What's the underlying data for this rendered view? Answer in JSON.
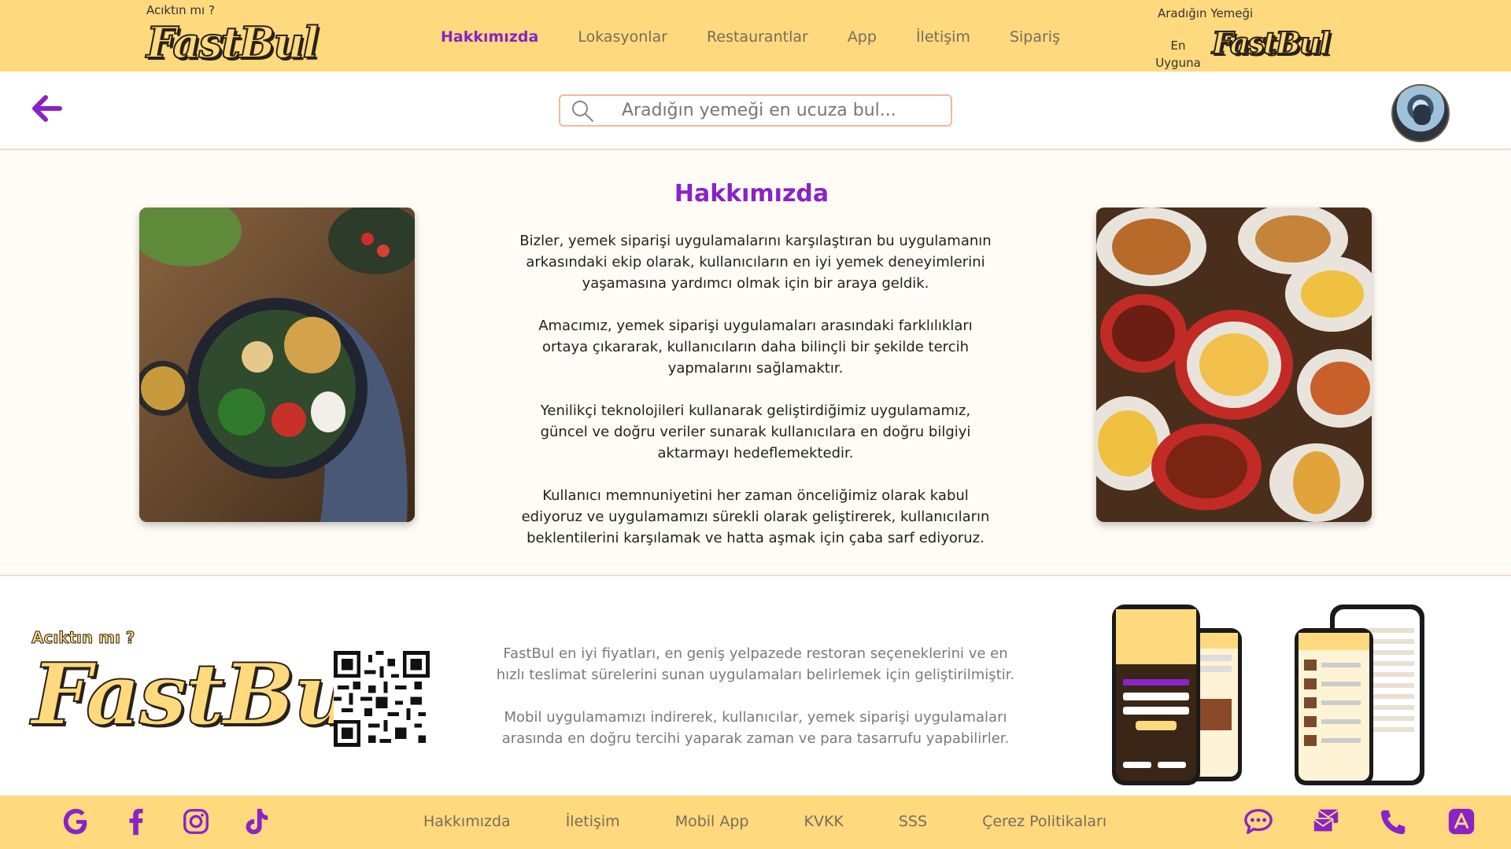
{
  "header": {
    "tagline": "Acıktın mı ?",
    "logo_text": "FastBul",
    "nav": [
      {
        "label": "Hakkımızda",
        "active": true
      },
      {
        "label": "Lokasyonlar",
        "active": false
      },
      {
        "label": "Restaurantlar",
        "active": false
      },
      {
        "label": "App",
        "active": false
      },
      {
        "label": "İletişim",
        "active": false
      },
      {
        "label": "Sipariş",
        "active": false
      }
    ],
    "right_tagline": "Aradığın Yemeği",
    "right_tagline_sub": "En Uyguna",
    "right_logo_text": "FastBul"
  },
  "search": {
    "placeholder": "Aradığın yemeği en ucuza bul..."
  },
  "about": {
    "title": "Hakkımızda",
    "paragraphs": [
      "Bizler, yemek siparişi uygulamalarını karşılaştıran bu uygulamanın arkasındaki ekip olarak, kullanıcıların en iyi yemek deneyimlerini yaşamasına yardımcı olmak için bir araya geldik.",
      "Amacımız, yemek siparişi uygulamaları arasındaki farklılıkları ortaya çıkararak, kullanıcıların daha bilinçli bir şekilde tercih yapmalarını sağlamaktır.",
      "Yenilikçi teknolojileri kullanarak geliştirdiğimiz uygulamamız, güncel ve doğru veriler sunarak kullanıcılara en doğru bilgiyi aktarmayı hedeflemektedir.",
      "Kullanıcı memnuniyetini her zaman önceliğimiz olarak kabul ediyoruz ve uygulamamızı sürekli olarak geliştirerek, kullanıcıların beklentilerini karşılamak ve hatta aşmak için çaba sarf ediyoruz."
    ]
  },
  "footer_info": {
    "tagline": "Acıktın mı ?",
    "logo_text": "FastBul",
    "paragraphs": [
      "FastBul en iyi fiyatları, en geniş yelpazede restoran seçeneklerini ve en hızlı teslimat sürelerini sunan uygulamaları belirlemek için geliştirilmiştir.",
      "Mobil uygulamamızı indirerek, kullanıcılar, yemek siparişi uygulamaları arasında en doğru tercihi yaparak zaman ve para tasarrufu yapabilirler."
    ]
  },
  "bottom_bar": {
    "social_icons": [
      "google-icon",
      "facebook-icon",
      "instagram-icon",
      "tiktok-icon"
    ],
    "links": [
      "Hakkımızda",
      "İletişim",
      "Mobil App",
      "KVKK",
      "SSS",
      "Çerez Politikaları"
    ],
    "contact_icons": [
      "chat-icon",
      "mail-icon",
      "phone-icon",
      "app-store-icon"
    ]
  },
  "colors": {
    "brand_yellow": "#fed97e",
    "accent_purple": "#8a22c7",
    "divider": "#f8d9c8"
  }
}
